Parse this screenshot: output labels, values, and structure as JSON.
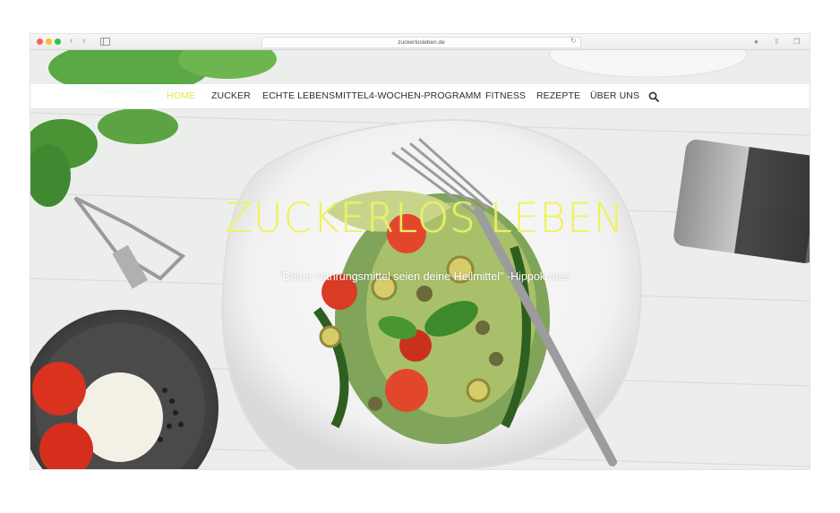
{
  "browser": {
    "url": "zuckerlosleben.de",
    "back_icon": "chevron-left-icon",
    "forward_icon": "chevron-right-icon",
    "reload_icon": "reload-icon",
    "download_icon": "download-icon",
    "share_icon": "share-icon",
    "tabs_icon": "tabs-icon"
  },
  "nav": {
    "items": [
      {
        "label": "HOME",
        "active": true
      },
      {
        "label": "ZUCKER"
      },
      {
        "label": "ECHTE LEBENSMITTEL"
      },
      {
        "label": "4-WOCHEN-PROGRAMM"
      },
      {
        "label": "FITNESS"
      },
      {
        "label": "REZEPTE"
      },
      {
        "label": "ÜBER UNS"
      }
    ],
    "search_icon": "search-icon",
    "active_color": "#e2e64a"
  },
  "hero": {
    "title": "ZUCKERLOS LEBEN",
    "quote": "\"Deine Nahrungsmittel seien deine Heilmittel\" -Hippokrates",
    "title_color": "#eef25a"
  }
}
